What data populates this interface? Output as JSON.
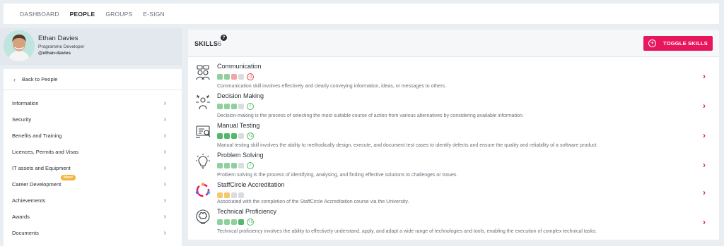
{
  "topnav": {
    "items": [
      {
        "label": "DASHBOARD",
        "active": false
      },
      {
        "label": "PEOPLE",
        "active": true
      },
      {
        "label": "GROUPS",
        "active": false
      },
      {
        "label": "E-SIGN",
        "active": false
      }
    ]
  },
  "profile": {
    "name": "Ethan Davies",
    "role": "Programme Developer",
    "handle": "@ethan-davies"
  },
  "sidebar": {
    "back_label": "Back to People",
    "items": [
      {
        "label": "Information"
      },
      {
        "label": "Security"
      },
      {
        "label": "Benefits and Training"
      },
      {
        "label": "Licences, Permits and Visas"
      },
      {
        "label": "IT assets and Equipment"
      },
      {
        "label": "Career Development",
        "badge": "New!"
      },
      {
        "label": "Achievements"
      },
      {
        "label": "Awards"
      },
      {
        "label": "Documents"
      }
    ]
  },
  "skills_panel": {
    "title": "SKILLS",
    "count": "6",
    "help_icon": "?",
    "toggle_label": "TOGGLE SKILLS",
    "items": [
      {
        "name": "Communication",
        "icon": "people-talk-icon",
        "level": [
          "green",
          "green",
          "red",
          "grey"
        ],
        "status": "warn",
        "status_text": "-1",
        "description": "Communication skill involves effectively and clearly conveying information, ideas, or messages to others."
      },
      {
        "name": "Decision Making",
        "icon": "decision-icon",
        "level": [
          "green",
          "green",
          "green",
          "grey"
        ],
        "status": "ok",
        "status_text": "✓",
        "description": "Decision-making is the process of selecting the most suitable course of action from various alternatives by considering available information."
      },
      {
        "name": "Manual Testing",
        "icon": "testing-icon",
        "level": [
          "green-dark",
          "green-dark",
          "green-dark",
          "grey"
        ],
        "status": "ok",
        "status_text": "+2",
        "description": "Manual testing skill involves the ability to methodically design, execute, and document test cases to identify defects and ensure the quality and reliability of a software product."
      },
      {
        "name": "Problem Solving",
        "icon": "lightbulb-icon",
        "level": [
          "green",
          "green",
          "green",
          "grey"
        ],
        "status": "ok",
        "status_text": "✓",
        "description": "Problem solving is the process of identifying, analysing, and finding effective solutions to challenges or issues."
      },
      {
        "name": "StaffCircle Accreditation",
        "icon": "staffcircle-logo-icon",
        "level": [
          "amber",
          "amber",
          "grey",
          "grey"
        ],
        "status": "",
        "status_text": "",
        "description": "Associated with the completion of the StaffCircle Accreditation course via the University."
      },
      {
        "name": "Technical Proficiency",
        "icon": "brain-gear-icon",
        "level": [
          "green",
          "green",
          "green",
          "green-dark"
        ],
        "status": "ok",
        "status_text": "+1",
        "description": "Technical proficiency involves the ability to effectively understand, apply, and adapt a wide range of technologies and tools, enabling the execution of complex technical tasks."
      }
    ]
  },
  "colors": {
    "accent": "#e8175d",
    "ok": "#4dbb62",
    "warn": "#e04545",
    "badge": "#f2b43a"
  }
}
